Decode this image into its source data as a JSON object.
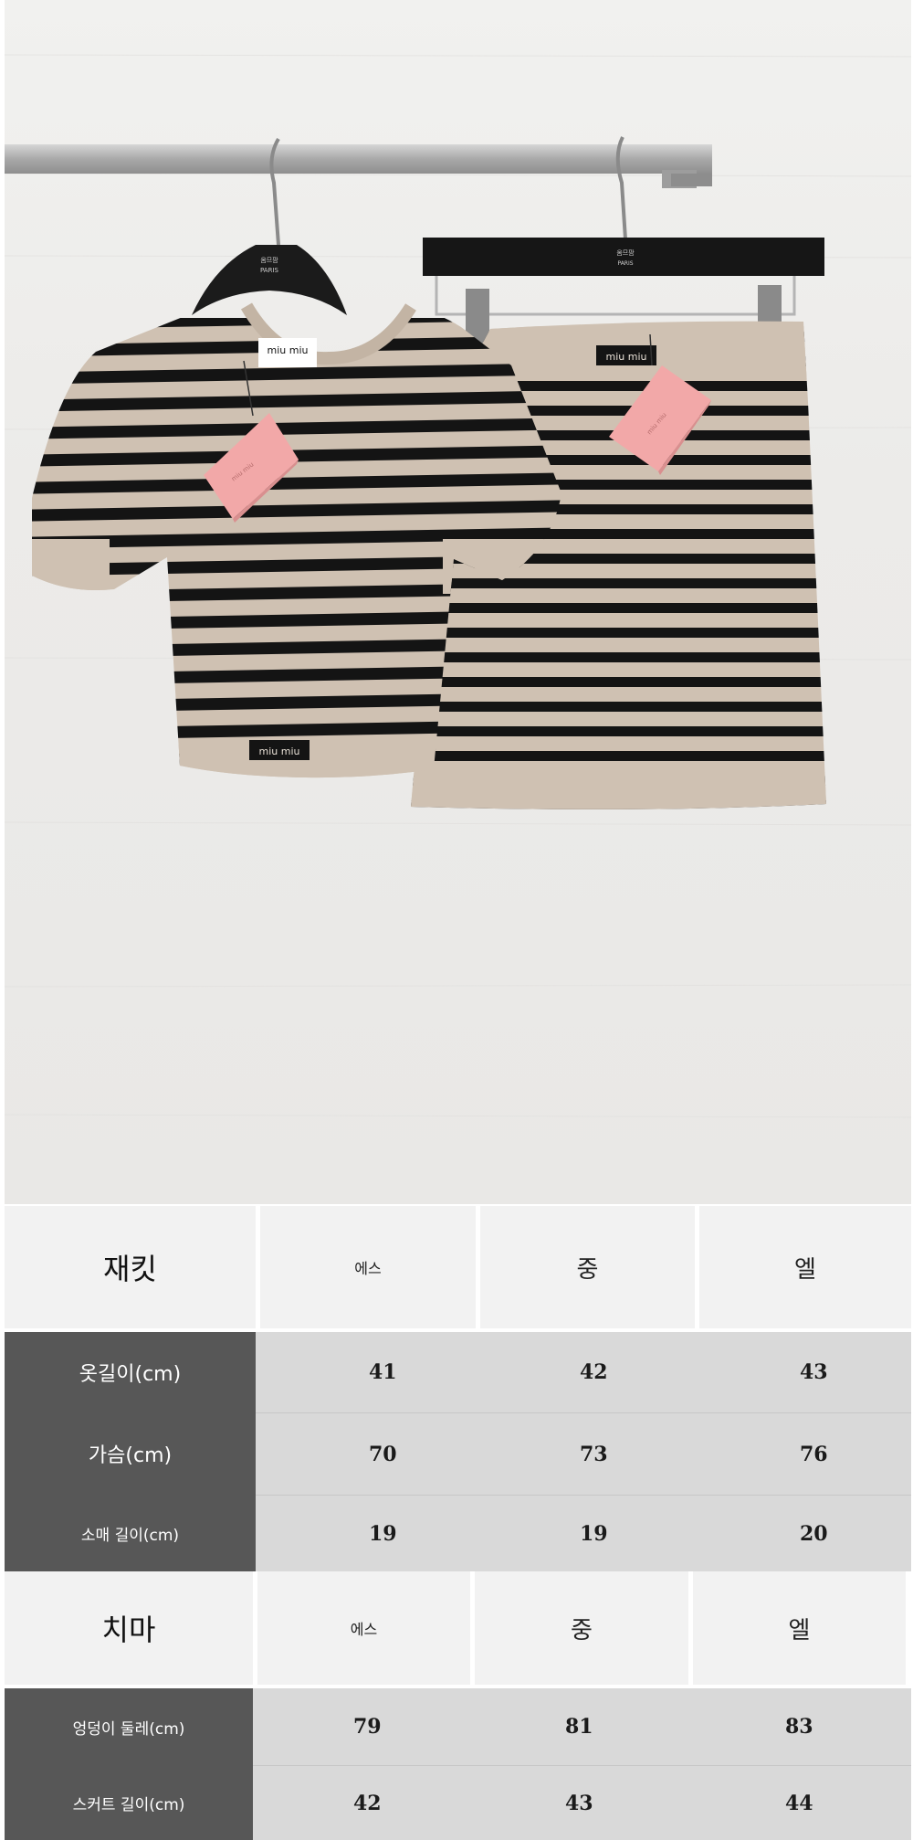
{
  "photo": {
    "top_tag": "miu miu",
    "hem_tag": "miu miu",
    "skirt_tag": "miu miu",
    "hanger_top": "PARIS",
    "colors": {
      "knit": "#cfc1b2",
      "stripe": "#141414",
      "hangtag": "#f2a8a8",
      "rail": "#b9b9b9"
    }
  },
  "jacket_table": {
    "title": "재킷",
    "sizes": [
      "에스",
      "중",
      "엘"
    ],
    "rows": [
      {
        "label": "옷길이(cm)",
        "values": [
          "41",
          "42",
          "43"
        ]
      },
      {
        "label": "가슴(cm)",
        "values": [
          "70",
          "73",
          "76"
        ]
      },
      {
        "label": "소매 길이(cm)",
        "values": [
          "19",
          "19",
          "20"
        ]
      }
    ]
  },
  "skirt_table": {
    "title": "치마",
    "sizes": [
      "에스",
      "중",
      "엘"
    ],
    "rows": [
      {
        "label": "엉덩이 둘레(cm)",
        "values": [
          "79",
          "81",
          "83"
        ]
      },
      {
        "label": "스커트 길이(cm)",
        "values": [
          "42",
          "43",
          "44"
        ]
      }
    ]
  }
}
